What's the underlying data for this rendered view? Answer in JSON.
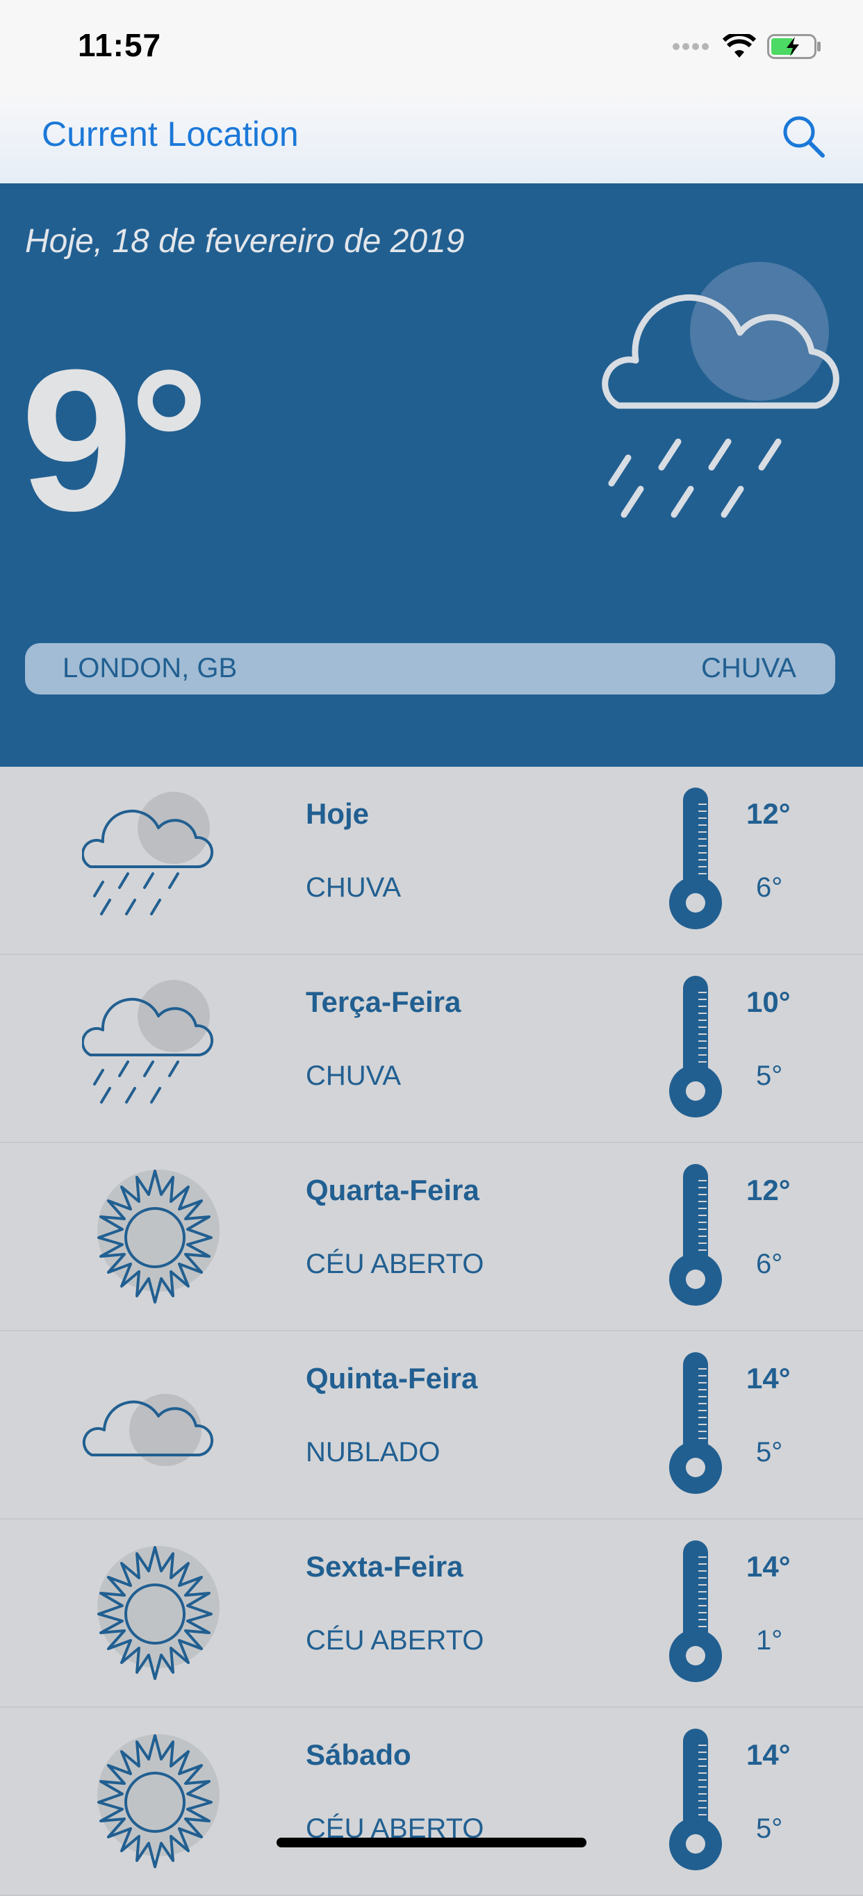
{
  "status": {
    "time": "11:57"
  },
  "nav": {
    "title": "Current Location",
    "search_icon": "search-icon"
  },
  "today": {
    "date": "Hoje, 18 de fevereiro de 2019",
    "temperature": "9°",
    "location": "LONDON, GB",
    "condition": "CHUVA",
    "icon": "cloud-rain-icon"
  },
  "forecast": [
    {
      "day": "Hoje",
      "condition": "CHUVA",
      "max": "12°",
      "min": "6°",
      "icon": "cloud-rain-icon"
    },
    {
      "day": "Terça-Feira",
      "condition": "CHUVA",
      "max": "10°",
      "min": "5°",
      "icon": "cloud-rain-icon"
    },
    {
      "day": "Quarta-Feira",
      "condition": "CÉU ABERTO",
      "max": "12°",
      "min": "6°",
      "icon": "sun-icon"
    },
    {
      "day": "Quinta-Feira",
      "condition": "NUBLADO",
      "max": "14°",
      "min": "5°",
      "icon": "cloud-icon"
    },
    {
      "day": "Sexta-Feira",
      "condition": "CÉU ABERTO",
      "max": "14°",
      "min": "1°",
      "icon": "sun-icon"
    },
    {
      "day": "Sábado",
      "condition": "CÉU ABERTO",
      "max": "14°",
      "min": "5°",
      "icon": "sun-icon"
    }
  ],
  "colors": {
    "accent": "#1b78d8",
    "primary": "#215f91",
    "background": "#d3d4d7"
  }
}
